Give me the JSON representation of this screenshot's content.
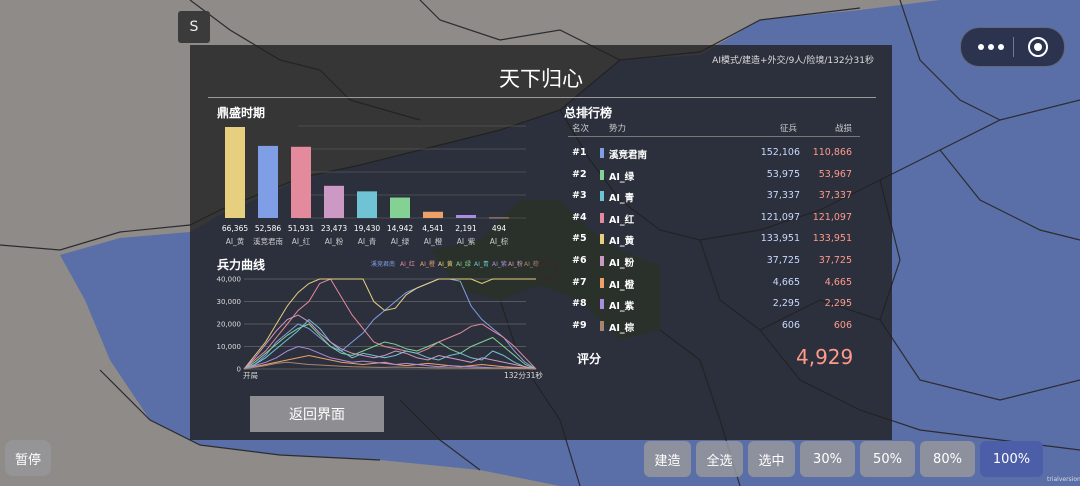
{
  "top_left_button": "S",
  "panel": {
    "title": "天下归心",
    "subtitle": "AI模式/建造+外交/9人/险境/132分31秒",
    "peak_section": "鼎盛时期",
    "troops_section": "兵力曲线",
    "ranking_section": "总排行榜",
    "ranking_headers": {
      "rank": "名次",
      "faction": "势力",
      "recruited": "征兵",
      "battle_losses": "战损"
    },
    "score_label": "评分",
    "score_value": "4,929",
    "return_button": "返回界面"
  },
  "peak_chart": {
    "type": "bar",
    "categories": [
      "AI_黄",
      "溪竞君南",
      "AI_红",
      "AI_粉",
      "AI_青",
      "AI_绿",
      "AI_橙",
      "AI_紫",
      "AI_棕"
    ],
    "values": [
      66365,
      52586,
      51931,
      23473,
      19430,
      14942,
      4541,
      2191,
      494
    ],
    "value_labels": [
      "66,365",
      "52,586",
      "51,931",
      "23,473",
      "19,430",
      "14,942",
      "4,541",
      "2,191",
      "494"
    ],
    "colors": [
      "#e6cf7e",
      "#7f9ee6",
      "#e38a9c",
      "#cc99c4",
      "#6fc3d4",
      "#83d193",
      "#eba167",
      "#a98de0",
      "#a78670"
    ],
    "ylim": [
      0,
      70000
    ]
  },
  "troop_chart": {
    "type": "line",
    "legend": [
      "溪竞君南",
      "AI_红",
      "AI_橙",
      "AI_黄",
      "AI_绿",
      "AI_青",
      "AI_紫",
      "AI_粉",
      "AI_棕"
    ],
    "legend_colors": [
      "#7f9ee6",
      "#e38a9c",
      "#eba167",
      "#e6cf7e",
      "#83d193",
      "#6fc3d4",
      "#a98de0",
      "#cc99c4",
      "#a78670"
    ],
    "y_ticks": [
      "40,000",
      "30,000",
      "20,000",
      "10,000",
      "0"
    ],
    "ylim": [
      0,
      40000
    ],
    "x_start_label": "开局",
    "x_end_label": "132分31秒",
    "series": [
      {
        "color": "#7f9ee6",
        "values": [
          0,
          2000,
          6000,
          12000,
          16000,
          20000,
          18000,
          14000,
          10000,
          8000,
          12000,
          16000,
          22000,
          26000,
          30000,
          34000,
          36000,
          38000,
          40000,
          40000,
          39000,
          28000,
          22000,
          18000,
          14000,
          8000,
          3000,
          0
        ]
      },
      {
        "color": "#e38a9c",
        "values": [
          0,
          4000,
          8000,
          14000,
          20000,
          26000,
          30000,
          38000,
          40000,
          32000,
          24000,
          18000,
          12000,
          10000,
          9000,
          8000,
          7000,
          9000,
          12000,
          14000,
          16000,
          19000,
          20000,
          17000,
          14000,
          10000,
          5000,
          0
        ]
      },
      {
        "color": "#e6cf7e",
        "values": [
          0,
          6000,
          12000,
          20000,
          28000,
          34000,
          38000,
          40000,
          40000,
          40000,
          40000,
          40000,
          30000,
          26000,
          27000,
          33000,
          36000,
          38000,
          40000,
          40000,
          40000,
          40000,
          38000,
          40000,
          40000,
          40000,
          40000,
          40000
        ]
      },
      {
        "color": "#83d193",
        "values": [
          0,
          3000,
          7000,
          11000,
          15000,
          18000,
          20000,
          15000,
          10000,
          7000,
          6000,
          8000,
          10000,
          12000,
          11000,
          9000,
          8000,
          10000,
          12000,
          9000,
          7000,
          10000,
          12000,
          14000,
          10000,
          6000,
          2000,
          0
        ]
      },
      {
        "color": "#6fc3d4",
        "values": [
          0,
          2000,
          5000,
          9000,
          13000,
          17000,
          22000,
          18000,
          12000,
          8000,
          5000,
          7000,
          6000,
          5000,
          6000,
          8000,
          7000,
          5000,
          4000,
          6000,
          7000,
          5000,
          4000,
          8000,
          6000,
          3000,
          1000,
          0
        ]
      },
      {
        "color": "#cc99c4",
        "values": [
          0,
          5000,
          11000,
          17000,
          22000,
          24000,
          21000,
          16000,
          12000,
          9000,
          7000,
          6000,
          5000,
          6000,
          8000,
          7000,
          5000,
          4000,
          6000,
          5000,
          4000,
          3000,
          5000,
          4000,
          3000,
          2000,
          1000,
          0
        ]
      },
      {
        "color": "#eba167",
        "values": [
          0,
          1000,
          2000,
          3000,
          4000,
          5000,
          6000,
          5000,
          4000,
          3000,
          2500,
          2000,
          2500,
          3000,
          2000,
          1500,
          2000,
          2500,
          2000,
          1500,
          1000,
          1500,
          2000,
          1500,
          1000,
          800,
          500,
          0
        ]
      },
      {
        "color": "#a98de0",
        "values": [
          0,
          1500,
          3000,
          5000,
          8000,
          10000,
          9000,
          7000,
          5000,
          4000,
          3000,
          3500,
          3000,
          2500,
          2000,
          2500,
          2000,
          1500,
          1000,
          1500,
          1200,
          1000,
          800,
          600,
          500,
          400,
          200,
          0
        ]
      },
      {
        "color": "#a78670",
        "values": [
          0,
          800,
          1500,
          2500,
          3000,
          2500,
          2000,
          1800,
          1500,
          1200,
          1000,
          900,
          800,
          700,
          900,
          800,
          700,
          600,
          500,
          600,
          500,
          400,
          300,
          400,
          300,
          200,
          100,
          0
        ]
      }
    ]
  },
  "ranking": [
    {
      "rank": "#1",
      "name": "溪竞君南",
      "color": "#7f9ee6",
      "recruited": "152,106",
      "losses": "110,866"
    },
    {
      "rank": "#2",
      "name": "AI_绿",
      "color": "#83d193",
      "recruited": "53,975",
      "losses": "53,967"
    },
    {
      "rank": "#3",
      "name": "AI_青",
      "color": "#6fc3d4",
      "recruited": "37,337",
      "losses": "37,337"
    },
    {
      "rank": "#4",
      "name": "AI_红",
      "color": "#e38a9c",
      "recruited": "121,097",
      "losses": "121,097"
    },
    {
      "rank": "#5",
      "name": "AI_黄",
      "color": "#e6cf7e",
      "recruited": "133,951",
      "losses": "133,951"
    },
    {
      "rank": "#6",
      "name": "AI_粉",
      "color": "#cc99c4",
      "recruited": "37,725",
      "losses": "37,725"
    },
    {
      "rank": "#7",
      "name": "AI_橙",
      "color": "#eba167",
      "recruited": "4,665",
      "losses": "4,665"
    },
    {
      "rank": "#8",
      "name": "AI_紫",
      "color": "#a98de0",
      "recruited": "2,295",
      "losses": "2,295"
    },
    {
      "rank": "#9",
      "name": "AI_棕",
      "color": "#a78670",
      "recruited": "606",
      "losses": "606"
    }
  ],
  "bottom_bar": {
    "pause": "暂停",
    "build": "建造",
    "select_all": "全选",
    "selected": "选中",
    "p30": "30%",
    "p50": "50%",
    "p80": "80%",
    "p100": "100%"
  },
  "watermark": "trialversion",
  "icons": {
    "menu": "more-dots-icon",
    "record": "target-icon"
  }
}
